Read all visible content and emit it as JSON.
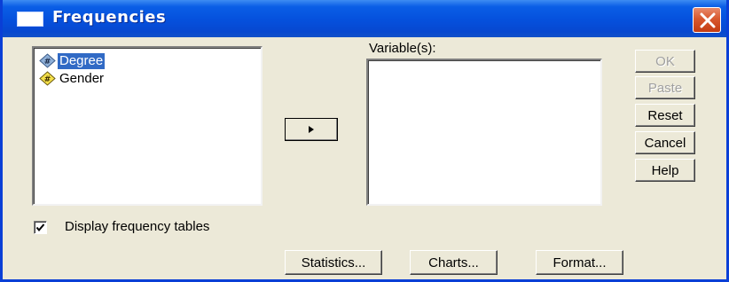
{
  "window": {
    "title": "Frequencies",
    "close_icon": "close-x-icon"
  },
  "source_list": {
    "items": [
      {
        "label": "Degree",
        "icon": "numeric-variable-icon",
        "selected": true
      },
      {
        "label": "Gender",
        "icon": "numeric-variable-icon",
        "selected": false
      }
    ]
  },
  "move_button": {
    "icon": "right-arrow-icon"
  },
  "target_list": {
    "label": "Variable(s):",
    "items": []
  },
  "side_buttons": {
    "ok": "OK",
    "paste": "Paste",
    "reset": "Reset",
    "cancel": "Cancel",
    "help": "Help"
  },
  "display_freq": {
    "label": "Display frequency tables",
    "checked": true
  },
  "bottom_buttons": {
    "statistics": "Statistics...",
    "charts": "Charts...",
    "format": "Format..."
  },
  "colors": {
    "titlebar": "#0550dc",
    "selection": "#316ac5",
    "dialog_bg": "#ece9d8",
    "close": "#d8582e"
  }
}
